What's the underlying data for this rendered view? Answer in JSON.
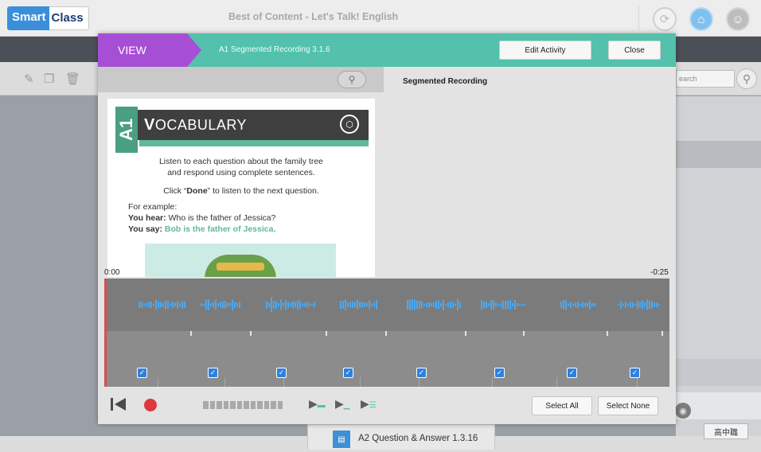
{
  "app": {
    "logo_smart": "Smart",
    "logo_class": "Class",
    "title": "Best of Content - Let's Talk! English"
  },
  "icons": {
    "sync": "sync-icon",
    "home": "home-icon",
    "user": "user-icon"
  },
  "background": {
    "search_placeholder": "earch",
    "bottom_item_label": "A2 Question & Answer 1.3.16",
    "ime_label": "高中職"
  },
  "modal": {
    "view_label": "VIEW",
    "activity_name": "A1 Segmented Recording 3.1.6",
    "edit_button": "Edit Activity",
    "close_button": "Close",
    "panel_title": "Segmented Recording"
  },
  "document": {
    "badge": "A1",
    "heading_first": "V",
    "heading_rest": "OCABULARY",
    "line1": "Listen to each question about the family tree",
    "line2": "and respond using complete sentences.",
    "line3_pre": "Click “",
    "line3_bold": "Done",
    "line3_post": "” to listen to the next question.",
    "example_label": "For example:",
    "hear_label": "You hear:",
    "hear_text": " Who is the father of Jessica?",
    "say_label": "You say:",
    "say_text": " Bob is the father of Jessica."
  },
  "audio": {
    "time_start": "0:00",
    "time_end": "-0:25",
    "segments": 8,
    "checked": [
      true,
      true,
      true,
      true,
      true,
      true,
      true,
      true
    ]
  },
  "transport": {
    "select_all": "Select All",
    "select_none": "Select None"
  },
  "colors": {
    "header_teal": "#53c1ac",
    "view_purple": "#a64fd5",
    "waveform_blue": "#4aa8f0",
    "record_red": "#e0373f",
    "checkbox_blue": "#2f7fe0"
  }
}
